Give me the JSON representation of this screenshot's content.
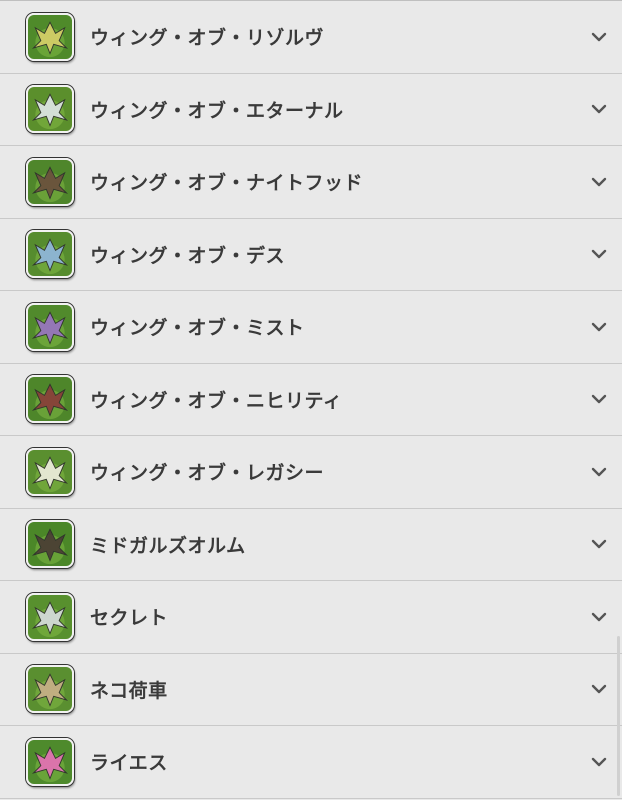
{
  "accordion": {
    "items": [
      {
        "label": "ウィング・オブ・リゾルヴ",
        "icon": "wing-of-resolve-icon",
        "icon_bg": "#4f8a2a",
        "icon_fg": "#d8d06a"
      },
      {
        "label": "ウィング・オブ・エターナル",
        "icon": "wing-of-eternal-icon",
        "icon_bg": "#5b8f2c",
        "icon_fg": "#dfe6e8"
      },
      {
        "label": "ウィング・オブ・ナイトフッド",
        "icon": "wing-of-knighthood-icon",
        "icon_bg": "#4f862b",
        "icon_fg": "#6b4d3e"
      },
      {
        "label": "ウィング・オブ・デス",
        "icon": "wing-of-death-icon",
        "icon_bg": "#568c2e",
        "icon_fg": "#8fb6e0"
      },
      {
        "label": "ウィング・オブ・ミスト",
        "icon": "wing-of-mist-icon",
        "icon_bg": "#518a2c",
        "icon_fg": "#9a73c4"
      },
      {
        "label": "ウィング・オブ・ニヒリティ",
        "icon": "wing-of-nihility-icon",
        "icon_bg": "#4e862a",
        "icon_fg": "#8a3b3a"
      },
      {
        "label": "ウィング・オブ・レガシー",
        "icon": "wing-of-legacy-icon",
        "icon_bg": "#5a8f2f",
        "icon_fg": "#efeee0"
      },
      {
        "label": "ミドガルズオルム",
        "icon": "midgardsormr-icon",
        "icon_bg": "#4b8728",
        "icon_fg": "#4a3a35"
      },
      {
        "label": "セクレト",
        "icon": "sekhret-icon",
        "icon_bg": "#58902e",
        "icon_fg": "#d8dde0"
      },
      {
        "label": "ネコ荷車",
        "icon": "neko-cart-icon",
        "icon_bg": "#5a8f30",
        "icon_fg": "#c9b08a"
      },
      {
        "label": "ライエス",
        "icon": "raiesu-icon",
        "icon_bg": "#4e8a2c",
        "icon_fg": "#e76fb9"
      }
    ],
    "chevron_icon": "chevron-down-icon",
    "chevron_color": "#555555",
    "text_color": "#3a3a3a",
    "row_bg": "#e9e9e9",
    "divider_color": "#c9c9c9"
  }
}
